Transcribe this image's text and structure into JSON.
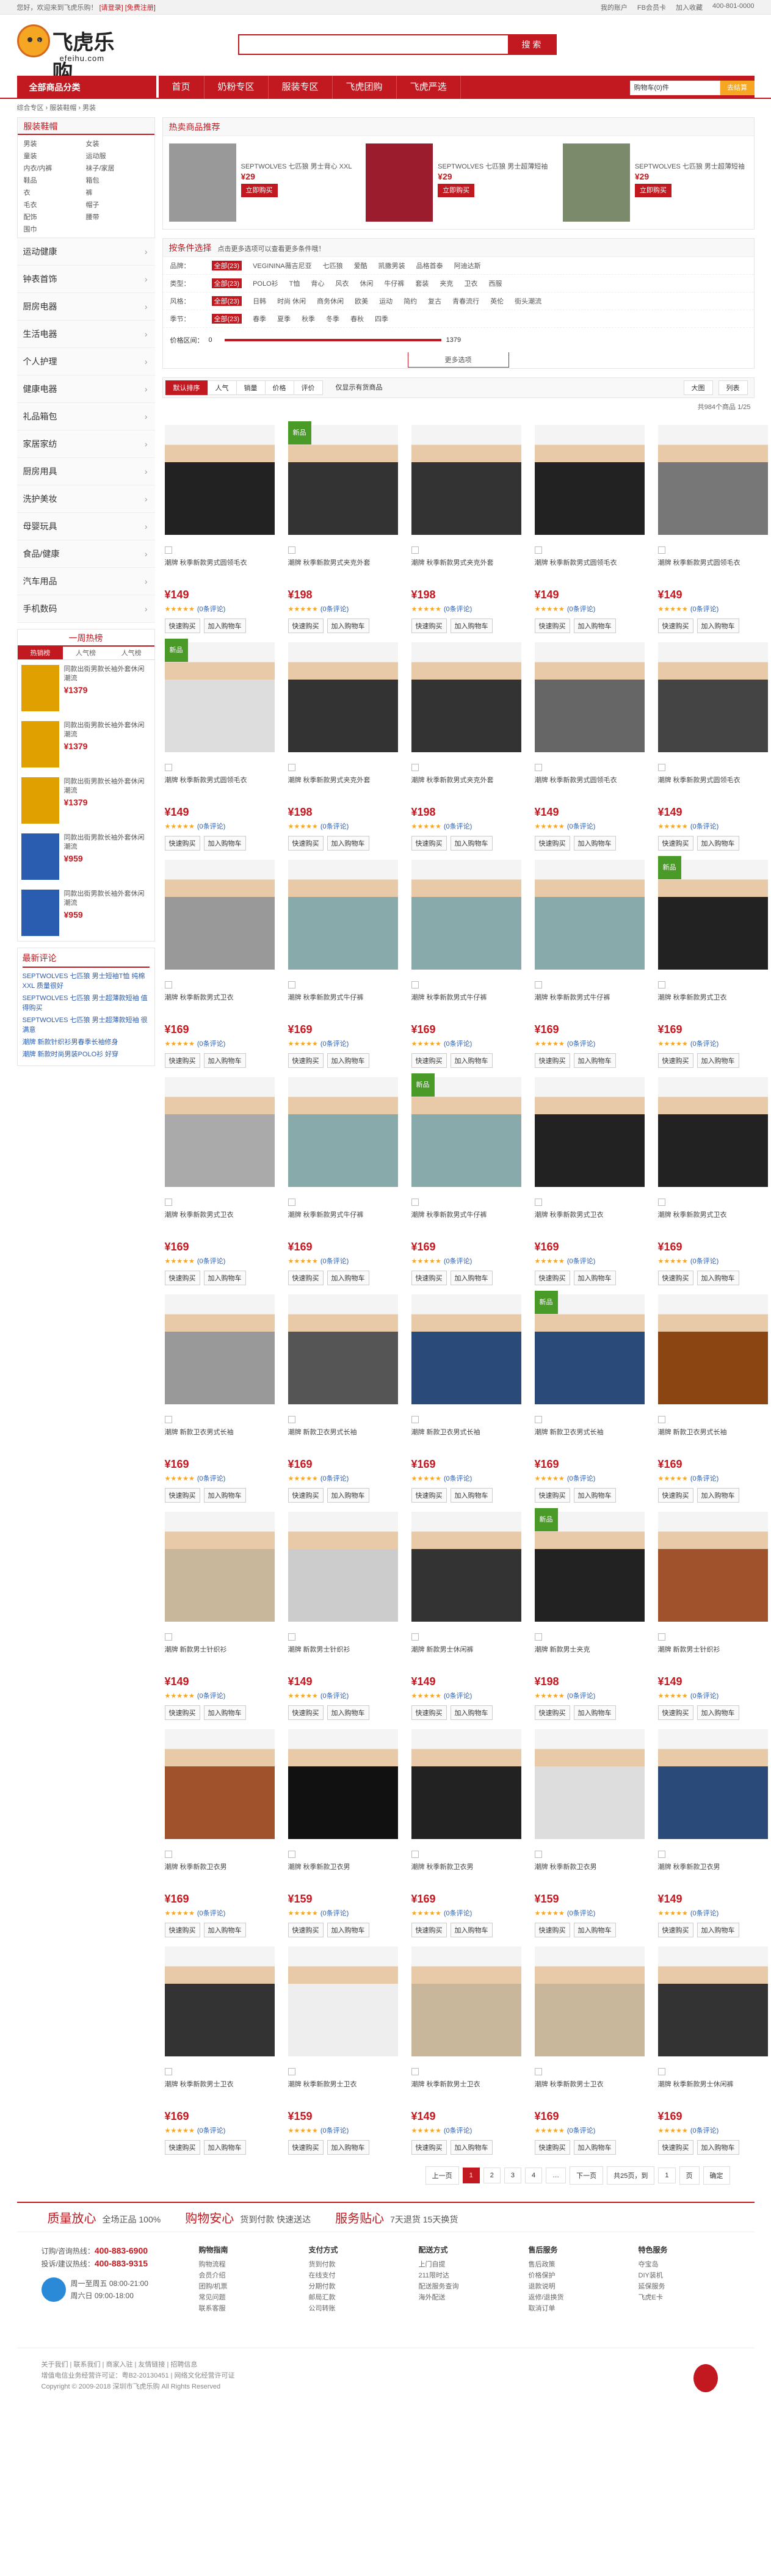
{
  "top": {
    "left": "您好，欢迎来到飞虎乐购！",
    "login": "[请登录]",
    "reg": "[免费注册]",
    "right": [
      "我的账户",
      "FB会员卡",
      "加入收藏",
      "400-801-0000"
    ]
  },
  "logo": {
    "title": "飞虎乐购",
    "url": "efeihu.com"
  },
  "search": {
    "placeholder": "",
    "button": "搜 索"
  },
  "nav": {
    "all": "全部商品分类",
    "items": [
      "首页",
      "奶粉专区",
      "服装专区",
      "飞虎团购",
      "飞虎严选"
    ]
  },
  "cart": {
    "label": "购物车(0)件",
    "btn": "去结算"
  },
  "crumb": "综合专区 › 服装鞋帽 › 男装",
  "left": {
    "title": "服装鞋帽",
    "subs": [
      "男装",
      "女装",
      "童装",
      "运动服",
      "内衣/内裤",
      "袜子/家居",
      "鞋品",
      "箱包",
      "衣",
      "裤",
      "毛衣",
      "帽子",
      "配饰",
      "腰带",
      "围巾"
    ],
    "cats": [
      "运动健康",
      "钟表首饰",
      "厨房电器",
      "生活电器",
      "个人护理",
      "健康电器",
      "礼品箱包",
      "家居家纺",
      "厨房用具",
      "洗护美妆",
      "母婴玩具",
      "食品/健康",
      "汽车用品",
      "手机数码"
    ],
    "hot_title": "一周热榜",
    "hot_tabs": [
      "热销榜",
      "人气榜",
      "人气榜"
    ],
    "hot": [
      {
        "t": "同款出街男款长袖外套休闲潮流",
        "p": "¥1379"
      },
      {
        "t": "同款出街男款长袖外套休闲潮流",
        "p": "¥1379"
      },
      {
        "t": "同款出街男款长袖外套休闲潮流",
        "p": "¥1379"
      },
      {
        "t": "同款出街男款长袖外套休闲潮流",
        "p": "¥959"
      },
      {
        "t": "同款出街男款长袖外套休闲潮流",
        "p": "¥959"
      }
    ],
    "rev_title": "最新评论",
    "revs": [
      "SEPTWOLVES 七匹狼 男士短袖T恤 纯棉 XXL 质量很好",
      "SEPTWOLVES 七匹狼 男士超薄款短袖 值得购买",
      "SEPTWOLVES 七匹狼 男士超薄款短袖 很满意",
      "潮牌 新款针织衫男春季长袖修身",
      "潮牌 新款时尚男装POLO衫 好穿"
    ]
  },
  "rec": {
    "title": "热卖商品推荐",
    "items": [
      {
        "t": "SEPTWOLVES 七匹狼 男士背心 XXL",
        "p": "¥29",
        "b": "立即购买"
      },
      {
        "t": "SEPTWOLVES 七匹狼 男士超薄短袖",
        "p": "¥29",
        "b": "立即购买"
      },
      {
        "t": "SEPTWOLVES 七匹狼 男士超薄短袖",
        "p": "¥29",
        "b": "立即购买"
      }
    ]
  },
  "filter": {
    "title": "按条件选择",
    "tip": "点击更多选项可以查看更多条件哦！",
    "rows": [
      {
        "k": "品牌：",
        "v": [
          "全部(23)",
          "VEGININA薇吉尼亚",
          "七匹狼",
          "爱酷",
          "凯撒男装",
          "品格首泰",
          "阿迪达斯"
        ]
      },
      {
        "k": "类型：",
        "v": [
          "全部(23)",
          "POLO衫",
          "T恤",
          "背心",
          "风衣",
          "休闲",
          "牛仔裤",
          "套装",
          "夹克",
          "卫衣",
          "西服"
        ]
      },
      {
        "k": "风格：",
        "v": [
          "全部(23)",
          "日韩",
          "时尚 休闲",
          "商务休闲",
          "欧美",
          "运动",
          "简约",
          "复古",
          "青春流行",
          "英伦",
          "街头潮流"
        ]
      },
      {
        "k": "季节：",
        "v": [
          "全部(23)",
          "春季",
          "夏季",
          "秋季",
          "冬季",
          "春秋",
          "四季"
        ]
      }
    ],
    "price_label": "价格区间：",
    "price_min": "0",
    "price_max": "1379",
    "more": "更多选项"
  },
  "sort": {
    "items": [
      "默认排序",
      "人气",
      "销量",
      "价格",
      "评价"
    ],
    "check": "仅显示有货商品",
    "right": [
      "大图",
      "列表"
    ]
  },
  "count": "共984个商品   1/25",
  "products": [
    {
      "n": "潮牌 秋季新款男式圆领毛衣",
      "p": "¥149",
      "new": false,
      "c": "#222"
    },
    {
      "n": "潮牌 秋季新款男式夹克外套",
      "p": "¥198",
      "new": true,
      "c": "#333"
    },
    {
      "n": "潮牌 秋季新款男式夹克外套",
      "p": "¥198",
      "new": false,
      "c": "#333"
    },
    {
      "n": "潮牌 秋季新款男式圆领毛衣",
      "p": "¥149",
      "new": false,
      "c": "#222"
    },
    {
      "n": "潮牌 秋季新款男式圆领毛衣",
      "p": "¥149",
      "new": false,
      "c": "#777"
    },
    {
      "n": "潮牌 秋季新款男式圆领毛衣",
      "p": "¥149",
      "new": true,
      "c": "#ddd"
    },
    {
      "n": "潮牌 秋季新款男式夹克外套",
      "p": "¥198",
      "new": false,
      "c": "#333"
    },
    {
      "n": "潮牌 秋季新款男式夹克外套",
      "p": "¥198",
      "new": false,
      "c": "#333"
    },
    {
      "n": "潮牌 秋季新款男式圆领毛衣",
      "p": "¥149",
      "new": false,
      "c": "#666"
    },
    {
      "n": "潮牌 秋季新款男式圆领毛衣",
      "p": "¥149",
      "new": false,
      "c": "#444"
    },
    {
      "n": "潮牌 秋季新款男式卫衣",
      "p": "¥169",
      "new": false,
      "c": "#999"
    },
    {
      "n": "潮牌 秋季新款男式牛仔裤",
      "p": "¥169",
      "new": false,
      "c": "#8aa"
    },
    {
      "n": "潮牌 秋季新款男式牛仔裤",
      "p": "¥169",
      "new": false,
      "c": "#8aa"
    },
    {
      "n": "潮牌 秋季新款男式牛仔裤",
      "p": "¥169",
      "new": false,
      "c": "#8aa"
    },
    {
      "n": "潮牌 秋季新款男式卫衣",
      "p": "¥169",
      "new": true,
      "c": "#222"
    },
    {
      "n": "潮牌 秋季新款男式卫衣",
      "p": "¥169",
      "new": false,
      "c": "#aaa"
    },
    {
      "n": "潮牌 秋季新款男式牛仔裤",
      "p": "¥169",
      "new": false,
      "c": "#8aa"
    },
    {
      "n": "潮牌 秋季新款男式牛仔裤",
      "p": "¥169",
      "new": true,
      "c": "#8aa"
    },
    {
      "n": "潮牌 秋季新款男式卫衣",
      "p": "¥169",
      "new": false,
      "c": "#222"
    },
    {
      "n": "潮牌 秋季新款男式卫衣",
      "p": "¥169",
      "new": false,
      "c": "#222"
    },
    {
      "n": "潮牌 新款卫衣男式长袖",
      "p": "¥169",
      "new": false,
      "c": "#999"
    },
    {
      "n": "潮牌 新款卫衣男式长袖",
      "p": "¥169",
      "new": false,
      "c": "#555"
    },
    {
      "n": "潮牌 新款卫衣男式长袖",
      "p": "¥169",
      "new": false,
      "c": "#2a4a7a"
    },
    {
      "n": "潮牌 新款卫衣男式长袖",
      "p": "¥169",
      "new": true,
      "c": "#2a4a7a"
    },
    {
      "n": "潮牌 新款卫衣男式长袖",
      "p": "¥169",
      "new": false,
      "c": "#8b4513"
    },
    {
      "n": "潮牌 新款男士针织衫",
      "p": "¥149",
      "new": false,
      "c": "#c9b79c"
    },
    {
      "n": "潮牌 新款男士针织衫",
      "p": "¥149",
      "new": false,
      "c": "#ccc"
    },
    {
      "n": "潮牌 新款男士休闲裤",
      "p": "¥149",
      "new": false,
      "c": "#333"
    },
    {
      "n": "潮牌 新款男士夹克",
      "p": "¥198",
      "new": true,
      "c": "#222"
    },
    {
      "n": "潮牌 新款男士针织衫",
      "p": "¥149",
      "new": false,
      "c": "#a0522d"
    },
    {
      "n": "潮牌 秋季新款卫衣男",
      "p": "¥169",
      "new": false,
      "c": "#a0522d"
    },
    {
      "n": "潮牌 秋季新款卫衣男",
      "p": "¥159",
      "new": false,
      "c": "#111"
    },
    {
      "n": "潮牌 秋季新款卫衣男",
      "p": "¥169",
      "new": false,
      "c": "#222"
    },
    {
      "n": "潮牌 秋季新款卫衣男",
      "p": "¥159",
      "new": false,
      "c": "#ddd"
    },
    {
      "n": "潮牌 秋季新款卫衣男",
      "p": "¥149",
      "new": false,
      "c": "#2a4a7a"
    },
    {
      "n": "潮牌 秋季新款男士卫衣",
      "p": "¥169",
      "new": false,
      "c": "#333"
    },
    {
      "n": "潮牌 秋季新款男士卫衣",
      "p": "¥159",
      "new": false,
      "c": "#eee"
    },
    {
      "n": "潮牌 秋季新款男士卫衣",
      "p": "¥149",
      "new": false,
      "c": "#c9b79c"
    },
    {
      "n": "潮牌 秋季新款男士卫衣",
      "p": "¥169",
      "new": false,
      "c": "#c9b79c"
    },
    {
      "n": "潮牌 秋季新款男士休闲裤",
      "p": "¥169",
      "new": false,
      "c": "#333"
    }
  ],
  "card": {
    "stars": "★★★★★",
    "review": "(0条评论)",
    "quick": "快速购买",
    "cart": "加入购物车"
  },
  "pager": [
    "上一页",
    "1",
    "2",
    "3",
    "4",
    "…",
    "下一页",
    "共25页，到",
    "1",
    "页",
    "确定"
  ],
  "svc": [
    {
      "a": "质量放心",
      "b": "全场正品 100%"
    },
    {
      "a": "购物安心",
      "b": "货到付款  快速送达"
    },
    {
      "a": "服务贴心",
      "b": "7天退货 15天换货"
    }
  ],
  "foot": {
    "tel_label": "订购/咨询热线：",
    "tel1": "400-883-6900",
    "svc_label": "投诉/建议热线：",
    "tel2": "400-883-9315",
    "time1": "周一至周五 08:00-21:00",
    "time2": "周六日 09:00-18:00",
    "cols": [
      {
        "h": "购物指南",
        "l": [
          "购物流程",
          "会员介绍",
          "团购/机票",
          "常见问题",
          "联系客服"
        ]
      },
      {
        "h": "支付方式",
        "l": [
          "货到付款",
          "在线支付",
          "分期付款",
          "邮局汇款",
          "公司转账"
        ]
      },
      {
        "h": "配送方式",
        "l": [
          "上门自提",
          "211限时达",
          "配送服务查询",
          "海外配送"
        ]
      },
      {
        "h": "售后服务",
        "l": [
          "售后政策",
          "价格保护",
          "退款说明",
          "返修/退换货",
          "取消订单"
        ]
      },
      {
        "h": "特色服务",
        "l": [
          "夺宝岛",
          "DIY装机",
          "延保服务",
          "飞虎E卡"
        ]
      }
    ]
  },
  "copy": [
    "关于我们 | 联系我们 | 商家入驻 | 友情链接 | 招聘信息",
    "增值电信业务经营许可证：粤B2-20130451 | 网络文化经营许可证",
    "Copyright © 2009-2018 深圳市飞虎乐购 All Rights Reserved"
  ]
}
